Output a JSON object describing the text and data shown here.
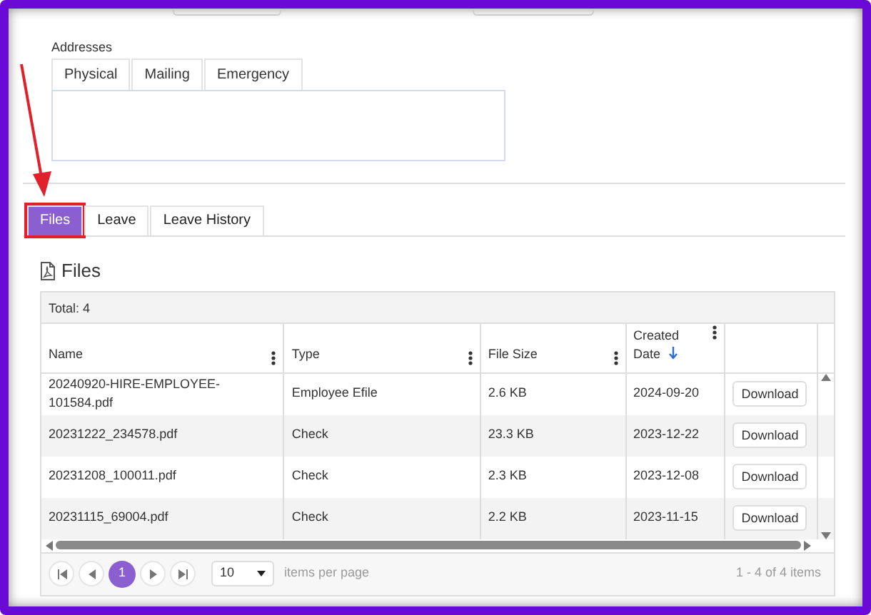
{
  "addresses": {
    "label": "Addresses",
    "tabs": [
      {
        "label": "Physical",
        "selected": false
      },
      {
        "label": "Mailing",
        "selected": false
      },
      {
        "label": "Emergency",
        "selected": false
      }
    ]
  },
  "callout_arrow": true,
  "tabs": [
    {
      "label": "Files",
      "selected": true,
      "highlighted": true
    },
    {
      "label": "Leave",
      "selected": false,
      "highlighted": false
    },
    {
      "label": "Leave History",
      "selected": false,
      "highlighted": false
    }
  ],
  "files": {
    "title": "Files",
    "total": "Total: 4",
    "columns": [
      {
        "label": "Name",
        "sorted": false
      },
      {
        "label": "Type",
        "sorted": false
      },
      {
        "label": "File Size",
        "sorted": false
      },
      {
        "label": "Created Date",
        "sorted": true
      }
    ],
    "rows": [
      {
        "cells": [
          "20240920-HIRE-EMPLOYEE-101584.pdf",
          "Employee Efile",
          "2.6 KB",
          "2024-09-20"
        ],
        "action": "Download"
      },
      {
        "cells": [
          "20231222_234578.pdf",
          "Check",
          "23.3 KB",
          "2023-12-22"
        ],
        "action": "Download"
      },
      {
        "cells": [
          "20231208_100011.pdf",
          "Check",
          "2.3 KB",
          "2023-12-08"
        ],
        "action": "Download"
      },
      {
        "cells": [
          "20231115_69004.pdf",
          "Check",
          "2.2 KB",
          "2023-11-15"
        ],
        "action": "Download"
      }
    ],
    "pager": {
      "pages": [
        {
          "label": "1",
          "selected": true
        }
      ],
      "page_size": "10",
      "page_size_label": "items per page",
      "summary": "1 - 4 of 4 items"
    }
  }
}
